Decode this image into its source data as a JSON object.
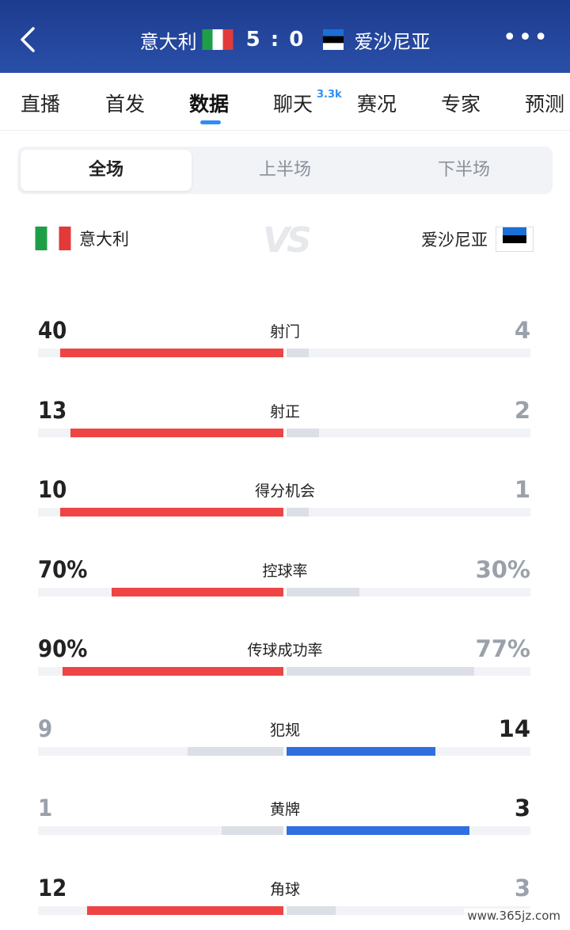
{
  "header": {
    "home_team": "意大利",
    "away_team": "爱沙尼亚",
    "score": "5 : 0",
    "more_icon": "more-dots-icon",
    "back_icon": "chevron-left-icon"
  },
  "tabs": [
    {
      "label": "直播"
    },
    {
      "label": "首发"
    },
    {
      "label": "数据",
      "active": true
    },
    {
      "label": "聊天",
      "badge": "3.3k"
    },
    {
      "label": "赛况"
    },
    {
      "label": "专家"
    },
    {
      "label": "预测"
    }
  ],
  "segment": [
    "全场",
    "上半场",
    "下半场"
  ],
  "teams": {
    "home": "意大利",
    "vs": "VS",
    "away": "爱沙尼亚"
  },
  "colors": {
    "home_bar": "#ee4444",
    "away_bar": "#2f6fe0",
    "neutral_bar": "#dcdfe5",
    "header": "#1d3c8f",
    "accent": "#2f8ef5"
  },
  "stats": [
    {
      "name": "射门",
      "home": "40",
      "away": "4",
      "home_frac": 0.909,
      "away_frac": 0.091,
      "winner": "home"
    },
    {
      "name": "射正",
      "home": "13",
      "away": "2",
      "home_frac": 0.867,
      "away_frac": 0.133,
      "winner": "home"
    },
    {
      "name": "得分机会",
      "home": "10",
      "away": "1",
      "home_frac": 0.909,
      "away_frac": 0.091,
      "winner": "home"
    },
    {
      "name": "控球率",
      "home": "70%",
      "away": "30%",
      "home_frac": 0.7,
      "away_frac": 0.3,
      "winner": "home"
    },
    {
      "name": "传球成功率",
      "home": "90%",
      "away": "77%",
      "home_frac": 0.9,
      "away_frac": 0.77,
      "winner": "home"
    },
    {
      "name": "犯规",
      "home": "9",
      "away": "14",
      "home_frac": 0.39,
      "away_frac": 0.61,
      "winner": "away"
    },
    {
      "name": "黄牌",
      "home": "1",
      "away": "3",
      "home_frac": 0.25,
      "away_frac": 0.75,
      "winner": "away"
    },
    {
      "name": "角球",
      "home": "12",
      "away": "3",
      "home_frac": 0.8,
      "away_frac": 0.2,
      "winner": "home"
    }
  ],
  "watermark": "www.365jz.com"
}
